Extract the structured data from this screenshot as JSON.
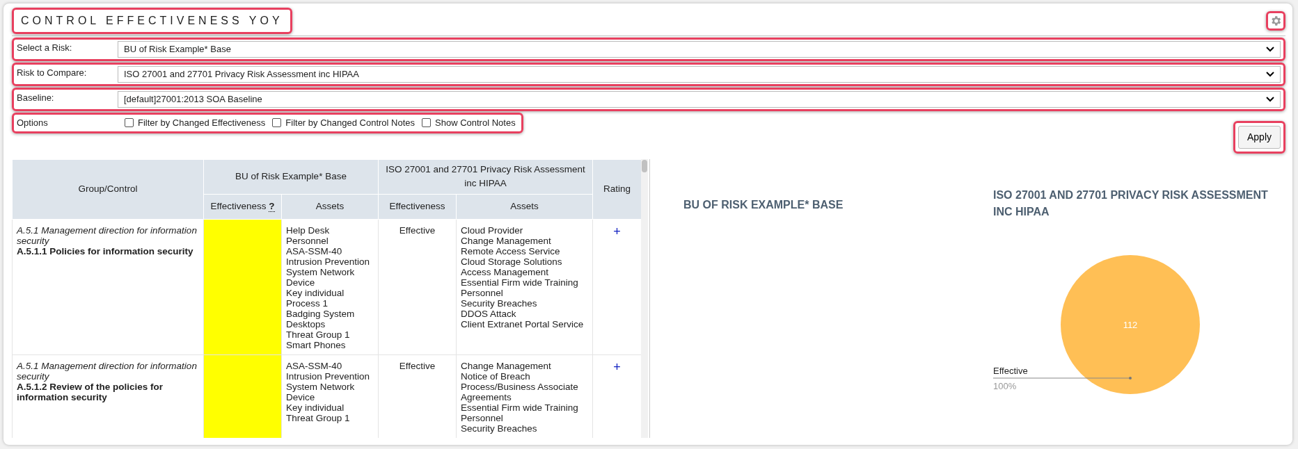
{
  "header": {
    "title": "CONTROL EFFECTIVENESS YOY"
  },
  "filters": [
    {
      "label": "Select a Risk:",
      "value": "BU of Risk Example* Base"
    },
    {
      "label": "Risk to Compare:",
      "value": "ISO 27001 and 27701 Privacy Risk Assessment inc HIPAA"
    },
    {
      "label": "Baseline:",
      "value": "[default]27001:2013 SOA Baseline"
    }
  ],
  "options": {
    "label": "Options",
    "checkboxes": [
      {
        "label": "Filter by Changed Effectiveness",
        "checked": false
      },
      {
        "label": "Filter by Changed Control Notes",
        "checked": false
      },
      {
        "label": "Show Control Notes",
        "checked": false
      }
    ]
  },
  "apply_button": "Apply",
  "table": {
    "group_heading": "Group/Control",
    "rating_heading": "Rating",
    "column_groups": [
      {
        "title": "BU of Risk Example* Base",
        "effectiveness_heading": "Effectiveness",
        "help": "?",
        "assets_heading": "Assets"
      },
      {
        "title": "ISO 27001 and 27701 Privacy Risk Assessment inc HIPAA",
        "effectiveness_heading": "Effectiveness",
        "assets_heading": "Assets"
      }
    ],
    "rows": [
      {
        "group": "A.5.1 Management direction for information security",
        "control": "A.5.1.1 Policies for information security",
        "base": {
          "color": "#ffff00",
          "assets": [
            "Help Desk",
            "Personnel",
            "ASA-SSM-40",
            "Intrusion Prevention",
            "System Network Device",
            "Key individual",
            "Process 1",
            "Badging System",
            "Desktops",
            "Threat Group 1",
            "Smart Phones"
          ]
        },
        "compare": {
          "effectiveness": "Effective",
          "assets": [
            "Cloud Provider",
            "Change Management",
            "Remote Access Service",
            "Cloud Storage Solutions",
            "Access Management",
            "Essential Firm wide Training Personnel",
            "Security Breaches",
            "DDOS Attack",
            "Client Extranet Portal Service"
          ]
        },
        "rating": "+"
      },
      {
        "group": "A.5.1 Management direction for information security",
        "control": "A.5.1.2 Review of the policies for information security",
        "base": {
          "color": "#ffff00",
          "assets": [
            "ASA-SSM-40",
            "Intrusion Prevention",
            "System Network Device",
            "Key individual",
            "Threat Group 1"
          ]
        },
        "compare": {
          "effectiveness": "Effective",
          "assets": [
            "Change Management",
            "Notice of Breach",
            "Process/Business Associate Agreements",
            "Essential Firm wide Training Personnel",
            "Security Breaches"
          ]
        },
        "rating": "+"
      }
    ]
  },
  "charts": [
    {
      "title": "BU OF RISK EXAMPLE* BASE"
    },
    {
      "chart_data": {
        "type": "pie",
        "title": "ISO 27001 AND 27701 PRIVACY RISK ASSESSMENT INC HIPAA",
        "series": [
          {
            "name": "Effective",
            "color": "#ffbf55",
            "values": [
              112
            ]
          }
        ],
        "data_labels": true,
        "annotations": [
          {
            "text": "100%"
          }
        ]
      }
    }
  ]
}
